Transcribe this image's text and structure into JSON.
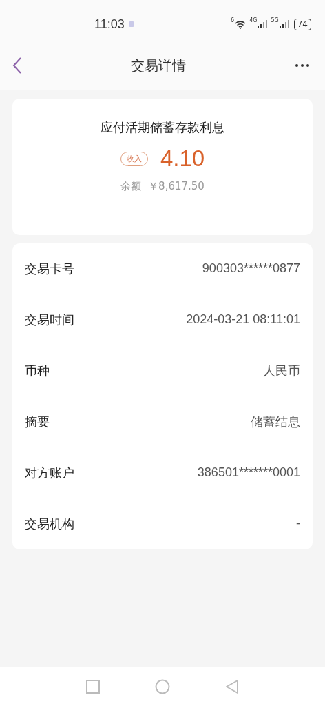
{
  "status_bar": {
    "time": "11:03",
    "wifi_label": "6",
    "signal_labels": [
      "4G",
      "5G"
    ],
    "battery": "74"
  },
  "header": {
    "title": "交易详情"
  },
  "summary": {
    "title": "应付活期储蓄存款利息",
    "tag": "收入",
    "amount": "4.10",
    "balance_label": "余额",
    "balance": "￥8,617.50"
  },
  "details": [
    {
      "label": "交易卡号",
      "value": "900303******0877"
    },
    {
      "label": "交易时间",
      "value": "2024-03-21 08:11:01"
    },
    {
      "label": "币种",
      "value": "人民币"
    },
    {
      "label": "摘要",
      "value": "储蓄结息"
    },
    {
      "label": "对方账户",
      "value": "386501*******0001"
    },
    {
      "label": "交易机构",
      "value": "-"
    }
  ]
}
